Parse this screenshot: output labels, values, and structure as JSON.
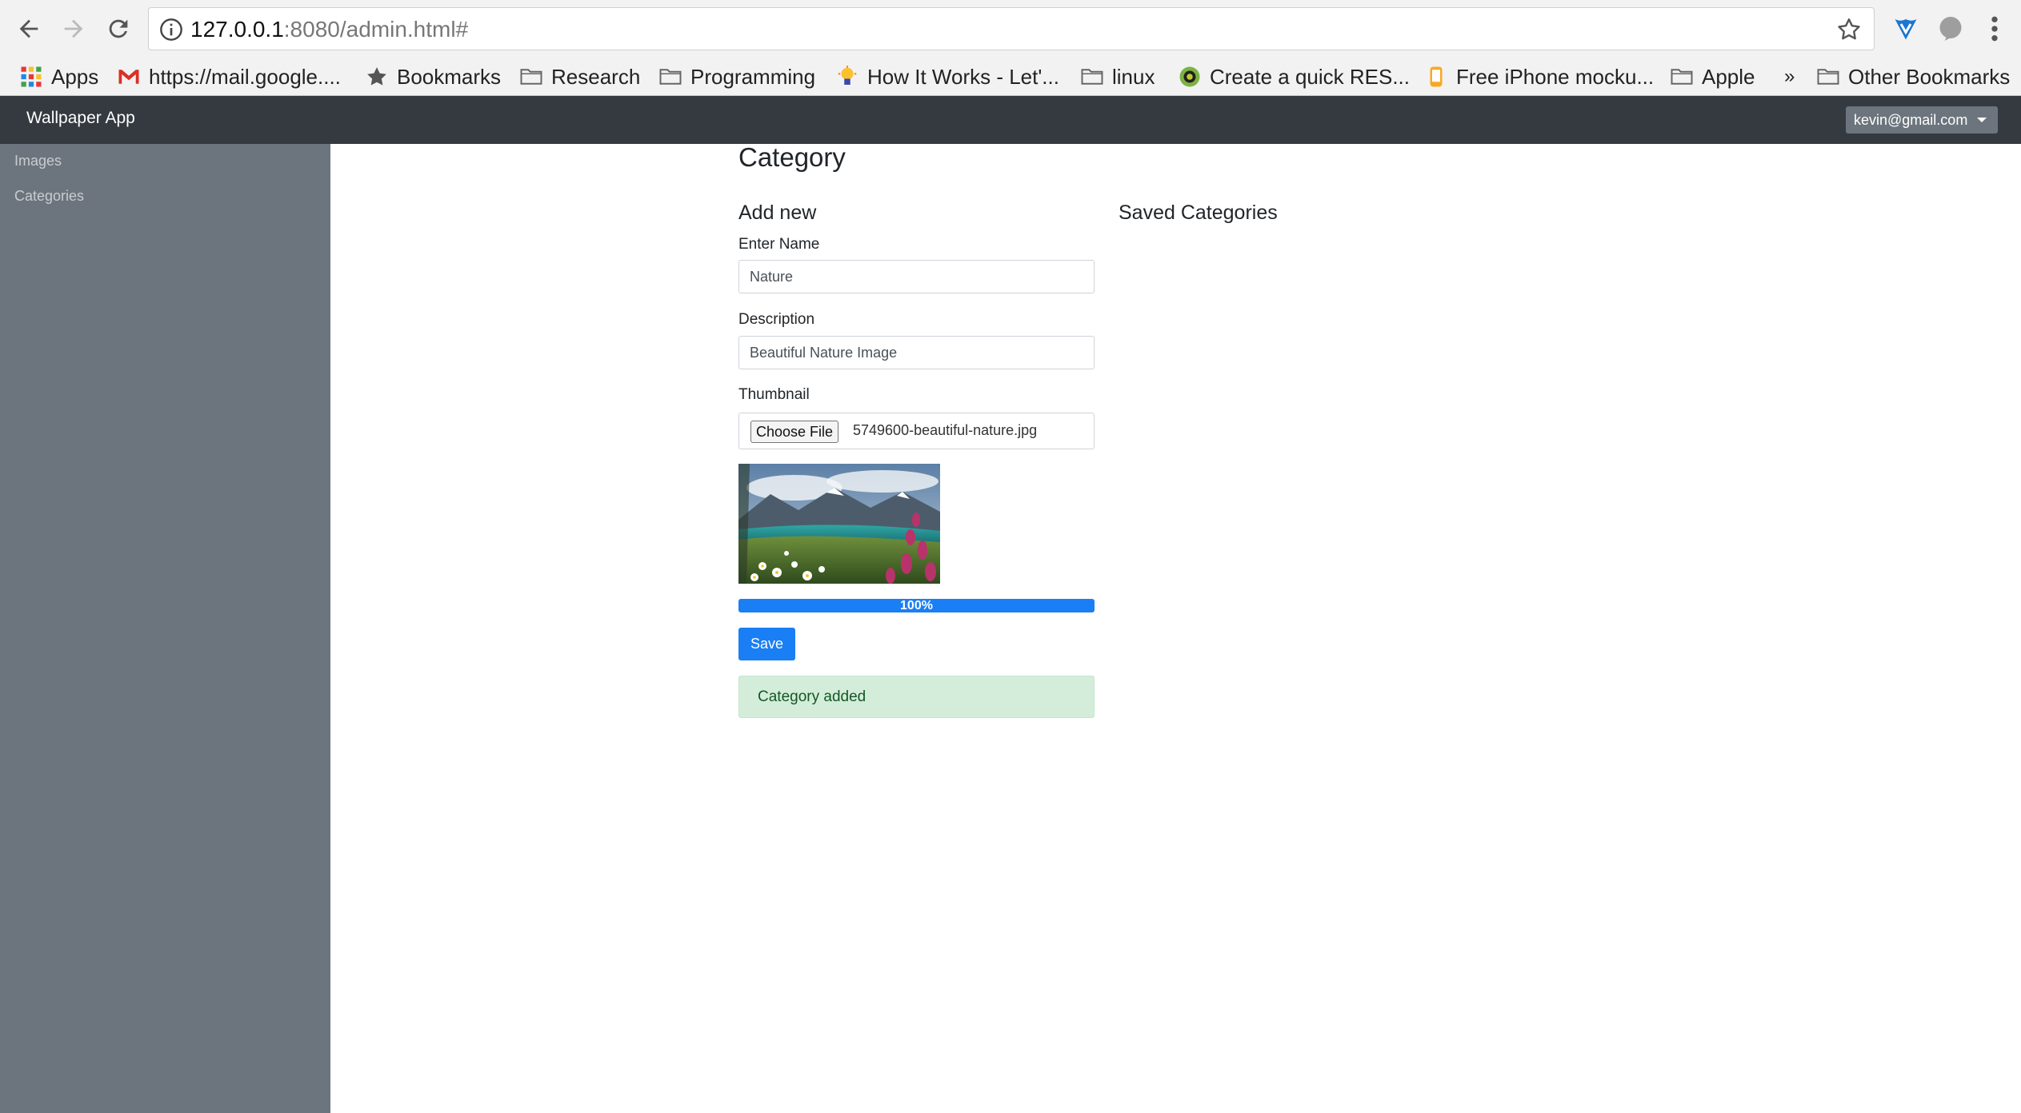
{
  "browser": {
    "url_host": "127.0.0.1",
    "url_rest": ":8080/admin.html#",
    "bookmarks": [
      {
        "label": "Apps",
        "icon": "apps-grid-icon"
      },
      {
        "label": "https://mail.google....",
        "icon": "gmail-icon"
      },
      {
        "label": "Bookmarks",
        "icon": "star-icon"
      },
      {
        "label": "Research",
        "icon": "folder-icon"
      },
      {
        "label": "Programming",
        "icon": "folder-icon"
      },
      {
        "label": "How It Works - Let'...",
        "icon": "lightbulb-icon"
      },
      {
        "label": "linux",
        "icon": "folder-icon"
      },
      {
        "label": "Create a quick RES...",
        "icon": "site-icon"
      },
      {
        "label": "Free iPhone mocku...",
        "icon": "site-icon"
      },
      {
        "label": "Apple",
        "icon": "folder-icon"
      },
      {
        "label": "»",
        "icon": ""
      },
      {
        "label": "Other Bookmarks",
        "icon": "folder-icon"
      }
    ]
  },
  "navbar": {
    "brand": "Wallpaper App",
    "user_email": "kevin@gmail.com"
  },
  "sidebar": {
    "items": [
      {
        "label": "Images"
      },
      {
        "label": "Categories"
      }
    ]
  },
  "main": {
    "title": "Category",
    "add_new_heading": "Add new",
    "saved_heading": "Saved Categories",
    "form": {
      "name_label": "Enter Name",
      "name_value": "Nature",
      "description_label": "Description",
      "description_value": "Beautiful Nature Image",
      "thumbnail_label": "Thumbnail",
      "choose_file_label": "Choose File",
      "file_name": "5749600-beautiful-nature.jpg",
      "progress_text": "100%",
      "progress_value": 1.0,
      "save_label": "Save",
      "alert_text": "Category added"
    }
  },
  "colors": {
    "navbar_bg": "#343a40",
    "sidebar_bg": "#6c757d",
    "primary": "#1a7ff5",
    "alert_bg": "#d4edda",
    "alert_text": "#155724"
  }
}
